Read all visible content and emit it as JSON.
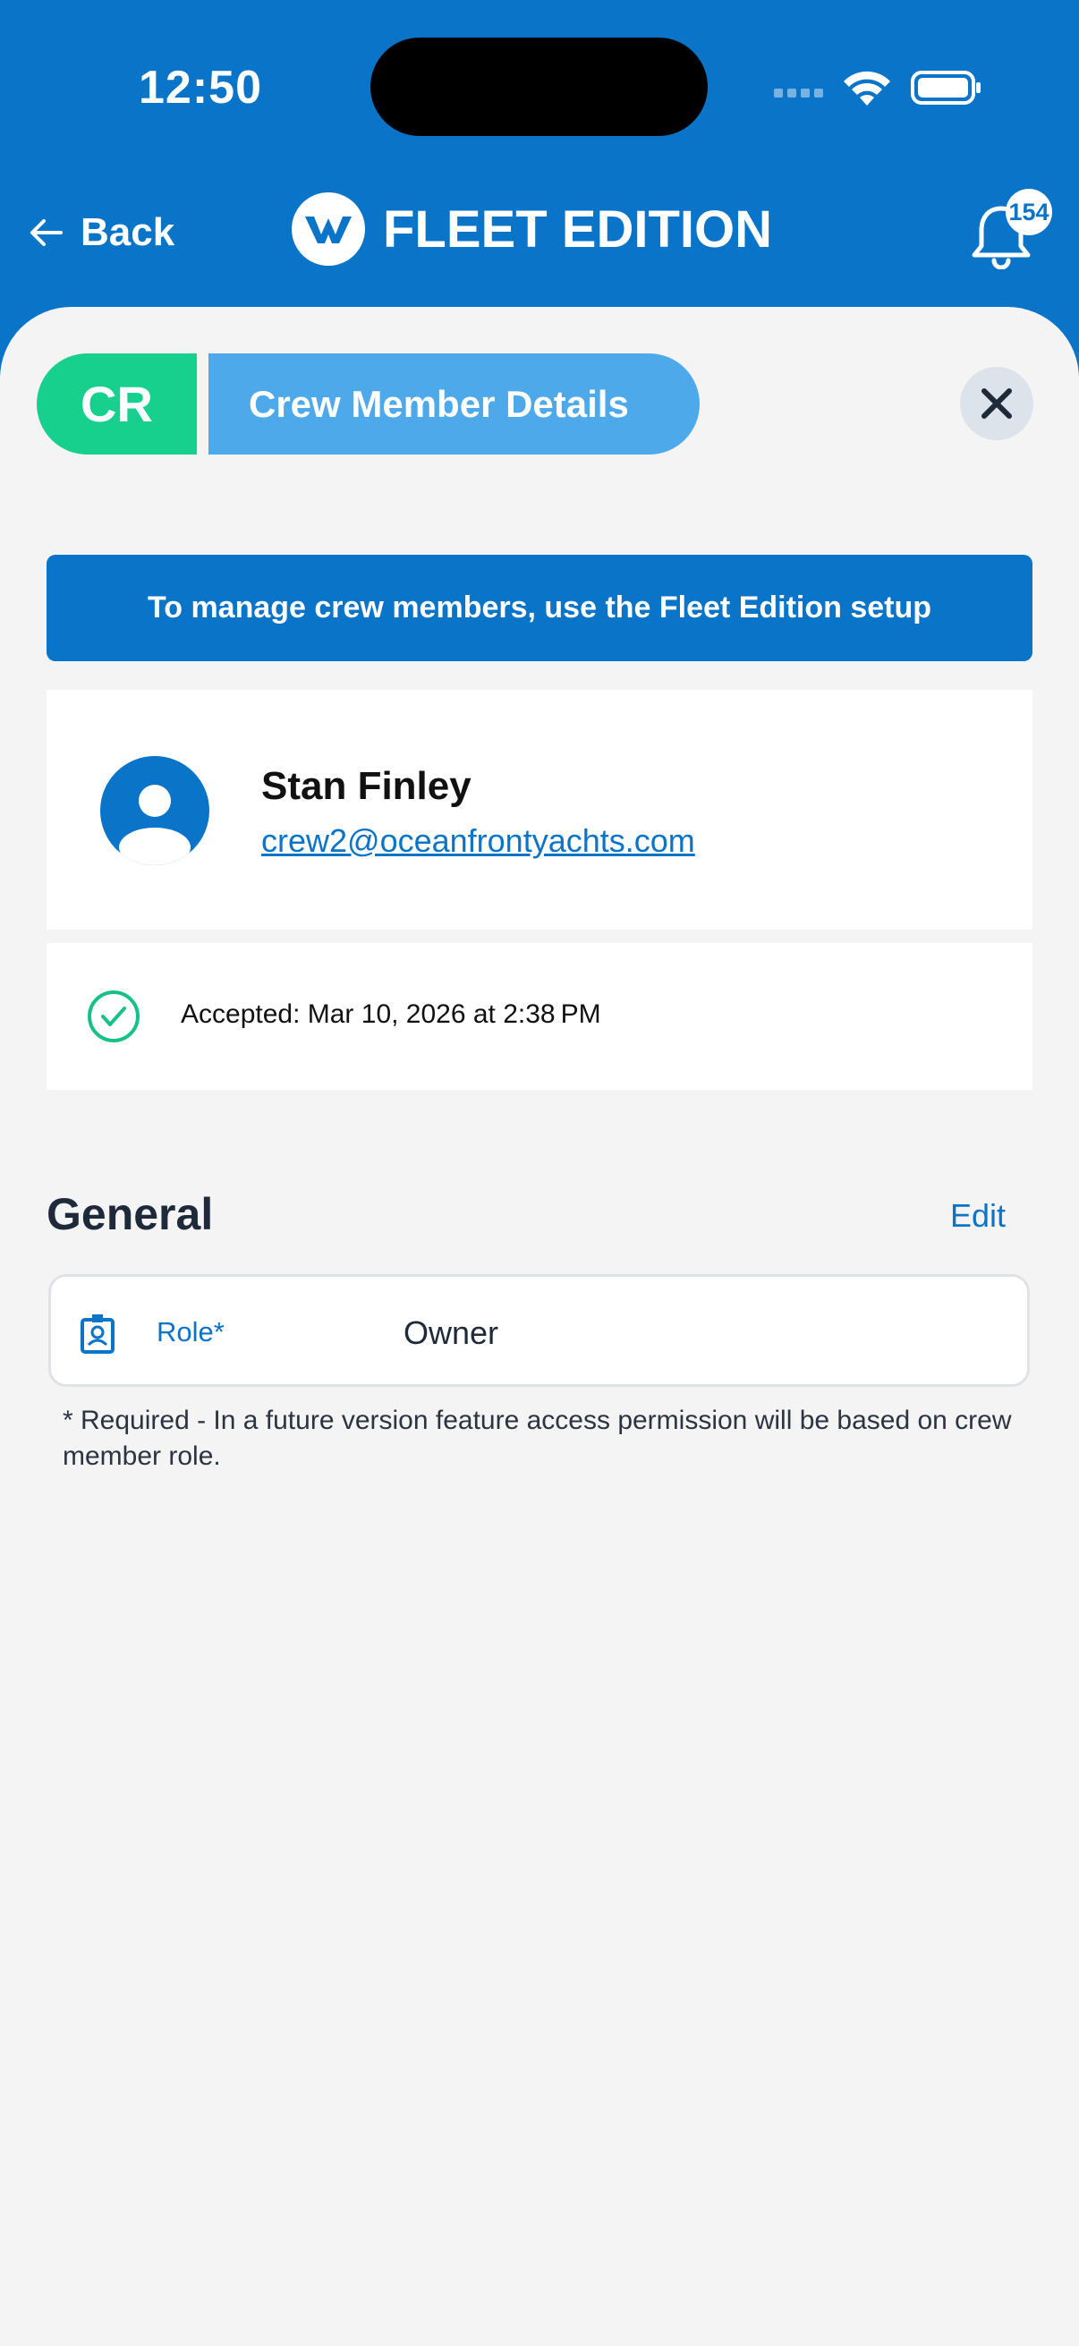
{
  "status_bar": {
    "time": "12:50"
  },
  "header": {
    "back_label": "Back",
    "brand_name": "FLEET EDITION",
    "notification_count": "154"
  },
  "title_bar": {
    "badge": "CR",
    "title": "Crew Member Details"
  },
  "banner": {
    "text": "To manage crew members, use the Fleet Edition setup"
  },
  "user": {
    "name": "Stan Finley",
    "email": "crew2@oceanfrontyachts.com"
  },
  "status": {
    "text": "Accepted: Mar 10, 2026 at 2:38 PM"
  },
  "general": {
    "title": "General",
    "edit_label": "Edit",
    "role_label": "Role*",
    "role_value": "Owner",
    "note": "* Required - In a future version feature access permission will be based on crew member role."
  },
  "colors": {
    "primary": "#0a74c8",
    "accent_green": "#17d08e",
    "light_blue": "#4ea9ea",
    "background": "#f4f4f5"
  }
}
